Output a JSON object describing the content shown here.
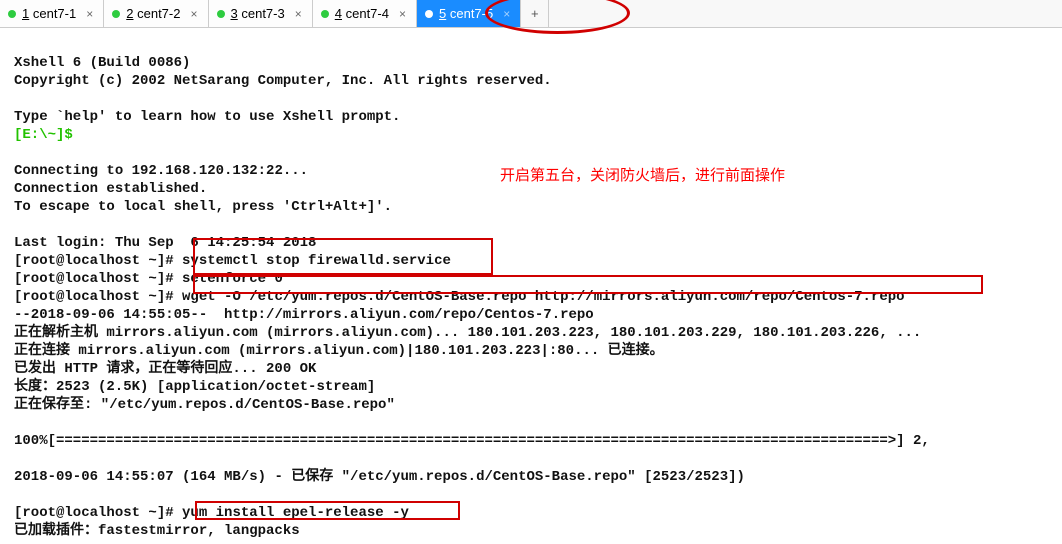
{
  "tabs": [
    {
      "num": "1",
      "name": "cent7-1",
      "active": false
    },
    {
      "num": "2",
      "name": "cent7-2",
      "active": false
    },
    {
      "num": "3",
      "name": "cent7-3",
      "active": false
    },
    {
      "num": "4",
      "name": "cent7-4",
      "active": false
    },
    {
      "num": "5",
      "name": "cent7-5",
      "active": true
    }
  ],
  "annotation_text": "开启第五台，关闭防火墙后，进行前面操作",
  "session": {
    "header": "Xshell 6 (Build 0086)",
    "copyright": "Copyright (c) 2002 NetSarang Computer, Inc. All rights reserved.",
    "help_hint": "Type `help' to learn how to use Xshell prompt.",
    "local_prompt": "[E:\\~]$",
    "connecting": "Connecting to 192.168.120.132:22...",
    "established": "Connection established.",
    "escape": "To escape to local shell, press 'Ctrl+Alt+]'.",
    "last_login": "Last login: Thu Sep  6 14:25:54 2018",
    "prompt": "[root@localhost ~]# ",
    "cmd1": "systemctl stop firewalld.service",
    "cmd2": "setenforce 0",
    "cmd3": "wget -O /etc/yum.repos.d/CentOS-Base.repo http://mirrors.aliyun.com/repo/Centos-7.repo",
    "wget1": "--2018-09-06 14:55:05--  http://mirrors.aliyun.com/repo/Centos-7.repo",
    "wget2": "正在解析主机 mirrors.aliyun.com (mirrors.aliyun.com)... 180.101.203.223, 180.101.203.229, 180.101.203.226, ...",
    "wget3": "正在连接 mirrors.aliyun.com (mirrors.aliyun.com)|180.101.203.223|:80... 已连接。",
    "wget4": "已发出 HTTP 请求，正在等待回应... 200 OK",
    "wget5": "长度：2523 (2.5K) [application/octet-stream]",
    "wget6": "正在保存至: \"/etc/yum.repos.d/CentOS-Base.repo\"",
    "progress": "100%[===================================================================================================>] 2,",
    "wget7": "2018-09-06 14:55:07 (164 MB/s) - 已保存 \"/etc/yum.repos.d/CentOS-Base.repo\" [2523/2523])",
    "cmd4": "yum install epel-release -y",
    "yum1": "已加载插件：fastestmirror, langpacks"
  }
}
